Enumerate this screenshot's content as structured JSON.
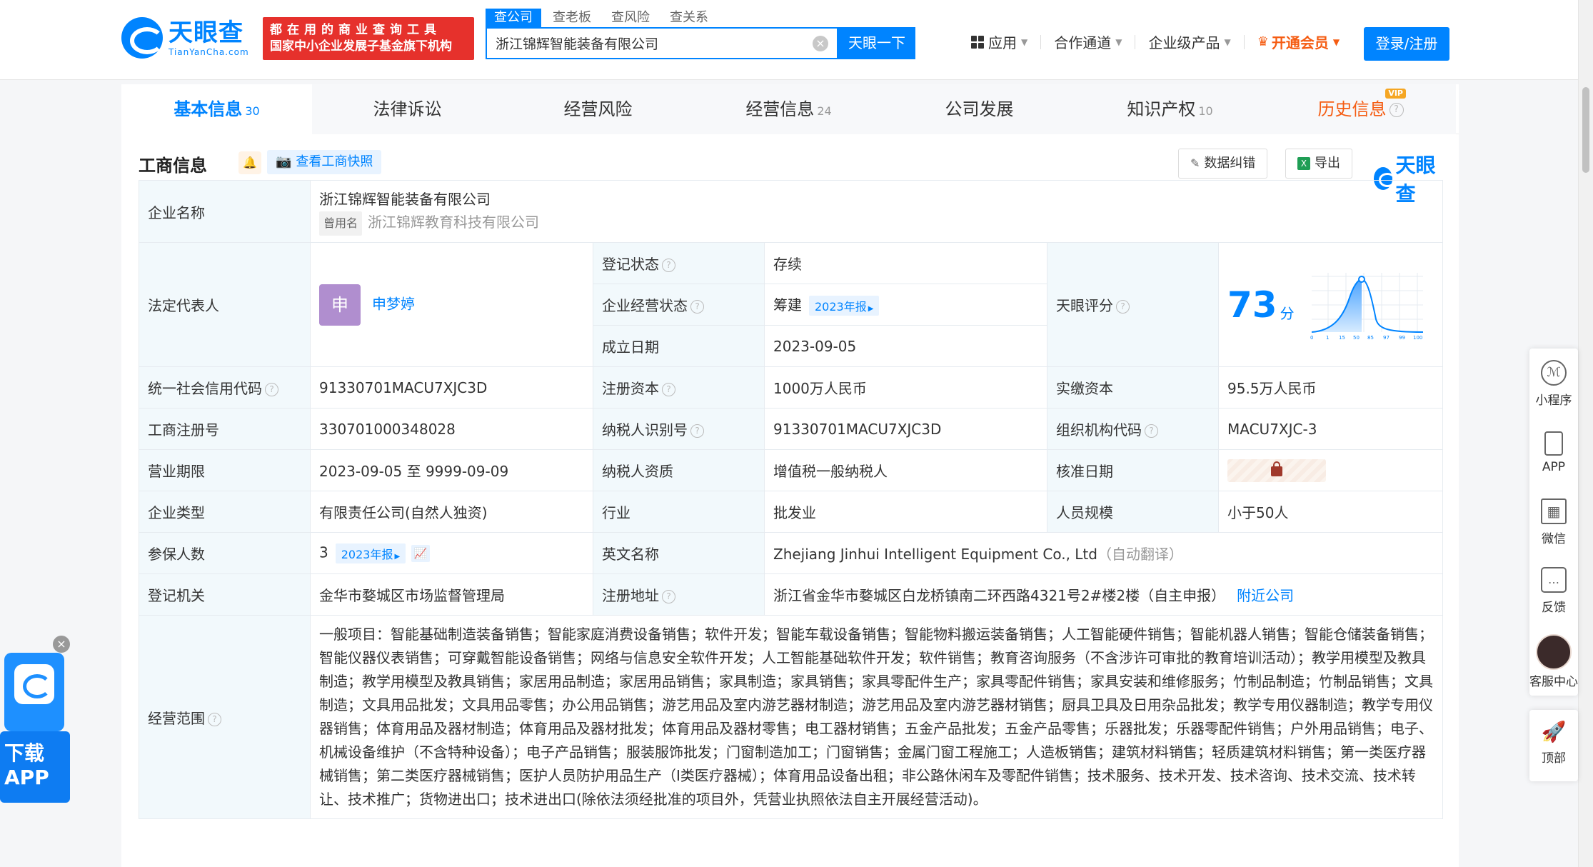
{
  "header": {
    "logo_cn": "天眼查",
    "logo_en": "TianYanCha.com",
    "slogan_line1": "都在用的商业查询工具",
    "slogan_line2": "国家中小企业发展子基金旗下机构",
    "search_tabs": [
      "查公司",
      "查老板",
      "查风险",
      "查关系"
    ],
    "search_value": "浙江锦辉智能装备有限公司",
    "search_button": "天眼一下",
    "nav": {
      "apps": "应用",
      "channel": "合作通道",
      "enterprise": "企业级产品",
      "vip": "开通会员"
    },
    "login": "登录/注册"
  },
  "tabs": [
    {
      "label": "基本信息",
      "count": "30"
    },
    {
      "label": "法律诉讼",
      "count": ""
    },
    {
      "label": "经营风险",
      "count": ""
    },
    {
      "label": "经营信息",
      "count": "24"
    },
    {
      "label": "公司发展",
      "count": ""
    },
    {
      "label": "知识产权",
      "count": "10"
    },
    {
      "label": "历史信息",
      "count": "",
      "badge": "VIP"
    }
  ],
  "section": {
    "title": "工商信息",
    "snapshot": "查看工商快照",
    "correct": "数据纠错",
    "export": "导出",
    "watermark": "天眼查"
  },
  "company": {
    "name_label": "企业名称",
    "name": "浙江锦辉智能装备有限公司",
    "former_tag": "曾用名",
    "former_name": "浙江锦辉教育科技有限公司",
    "legal_label": "法定代表人",
    "legal_avatar": "申",
    "legal_name": "申梦婷",
    "reg_status_label": "登记状态",
    "reg_status": "存续",
    "op_status_label": "企业经营状态",
    "op_status": "筹建",
    "annual_report_tag": "2023年报",
    "established_label": "成立日期",
    "established": "2023-09-05",
    "score_label": "天眼评分",
    "score": "73",
    "score_unit": "分",
    "score_axis": [
      "0",
      "1",
      "15",
      "50",
      "85",
      "97",
      "99",
      "100"
    ],
    "credit_label": "统一社会信用代码",
    "credit_code": "91330701MACU7XJC3D",
    "reg_capital_label": "注册资本",
    "reg_capital": "1000万人民币",
    "paid_capital_label": "实缴资本",
    "paid_capital": "95.5万人民币",
    "reg_no_label": "工商注册号",
    "reg_no": "330701000348028",
    "taxpayer_id_label": "纳税人识别号",
    "taxpayer_id": "91330701MACU7XJC3D",
    "org_code_label": "组织机构代码",
    "org_code": "MACU7XJC-3",
    "term_label": "营业期限",
    "term": "2023-09-05 至 9999-09-09",
    "taxpayer_qual_label": "纳税人资质",
    "taxpayer_qual": "增值税一般纳税人",
    "approve_label": "核准日期",
    "type_label": "企业类型",
    "type": "有限责任公司(自然人独资)",
    "industry_label": "行业",
    "industry": "批发业",
    "staff_label": "人员规模",
    "staff": "小于50人",
    "insured_label": "参保人数",
    "insured": "3",
    "insured_tag": "2023年报",
    "en_name_label": "英文名称",
    "en_name": "Zhejiang Jinhui Intelligent Equipment Co., Ltd",
    "en_name_note": "（自动翻译）",
    "authority_label": "登记机关",
    "authority": "金华市婺城区市场监督管理局",
    "address_label": "注册地址",
    "address": "浙江省金华市婺城区白龙桥镇南二环西路4321号2#楼2楼（自主申报）",
    "nearby": "附近公司",
    "scope_label": "经营范围",
    "scope": "一般项目：智能基础制造装备销售；智能家庭消费设备销售；软件开发；智能车载设备销售；智能物料搬运装备销售；人工智能硬件销售；智能机器人销售；智能仓储装备销售；智能仪器仪表销售；可穿戴智能设备销售；网络与信息安全软件开发；人工智能基础软件开发；软件销售；教育咨询服务（不含涉许可审批的教育培训活动）；教学用模型及教具制造；教学用模型及教具销售；家居用品制造；家居用品销售；家具制造；家具销售；家具零配件生产；家具零配件销售；家具安装和维修服务；竹制品制造；竹制品销售；文具制造；文具用品批发；文具用品零售；办公用品销售；游艺用品及室内游艺器材制造；游艺用品及室内游艺器材销售；厨具卫具及日用杂品批发；教学专用仪器制造；教学专用仪器销售；体育用品及器材制造；体育用品及器材批发；体育用品及器材零售；电工器材销售；五金产品批发；五金产品零售；乐器批发；乐器零配件销售；户外用品销售；电子、机械设备维护（不含特种设备）；电子产品销售；服装服饰批发；门窗制造加工；门窗销售；金属门窗工程施工；人造板销售；建筑材料销售；轻质建筑材料销售；第一类医疗器械销售；第二类医疗器械销售；医护人员防护用品生产（Ⅰ类医疗器械）；体育用品设备出租；非公路休闲车及零配件销售；技术服务、技术开发、技术咨询、技术交流、技术转让、技术推广；货物进出口；技术进出口(除依法须经批准的项目外，凭营业执照依法自主开展经营活动)。"
  },
  "side": {
    "mini": "小程序",
    "app": "APP",
    "wechat": "微信",
    "feedback": "反馈",
    "service": "客服中心",
    "top": "顶部"
  },
  "download": {
    "line1": "下载",
    "line2": "APP"
  },
  "colors": {
    "brand": "#0084ff",
    "status_green": "#12a150",
    "vip_orange": "#f55c12",
    "slogan_red": "#e6312c"
  }
}
